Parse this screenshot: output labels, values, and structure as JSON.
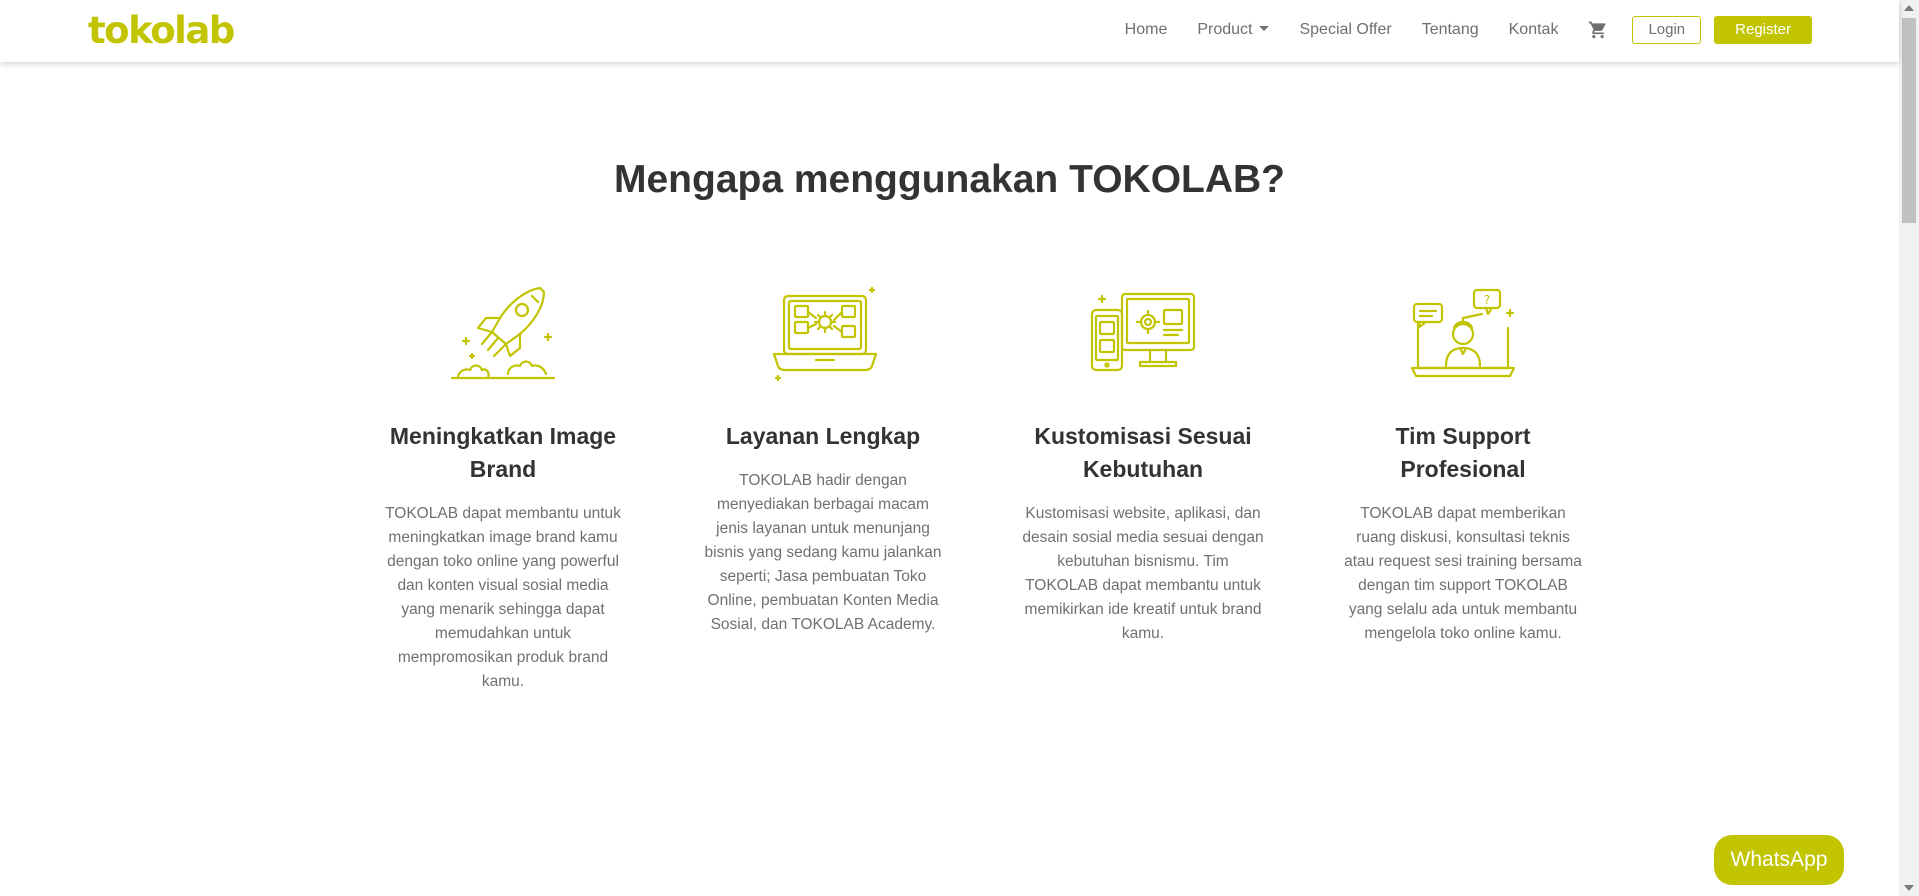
{
  "brand": {
    "name": "tokolab",
    "accent_color": "#c2c400"
  },
  "nav": {
    "home": "Home",
    "product": "Product",
    "special_offer": "Special Offer",
    "tentang": "Tentang",
    "kontak": "Kontak",
    "cart_icon": "shopping-cart-icon",
    "login": "Login",
    "register": "Register"
  },
  "main": {
    "title": "Mengapa menggunakan TOKOLAB?",
    "features": [
      {
        "icon": "rocket-icon",
        "title": "Meningkatkan Image Brand",
        "text": "TOKOLAB dapat membantu untuk meningkatkan image brand kamu dengan toko online yang powerful dan konten visual sosial media yang menarik sehingga dapat memudahkan untuk mempromosikan produk brand kamu."
      },
      {
        "icon": "laptop-settings-icon",
        "title": "Layanan Lengkap",
        "text": "TOKOLAB hadir dengan menyediakan berbagai macam jenis layanan untuk menunjang bisnis yang sedang kamu jalankan seperti; Jasa pembuatan Toko Online, pembuatan Konten Media Sosial, dan TOKOLAB Academy."
      },
      {
        "icon": "devices-customization-icon",
        "title": "Kustomisasi Sesuai Kebutuhan",
        "text": "Kustomisasi website, aplikasi, dan desain sosial media sesuai dengan kebutuhan bisnismu. Tim TOKOLAB dapat membantu untuk memikirkan ide kreatif untuk brand kamu."
      },
      {
        "icon": "support-person-icon",
        "title": "Tim Support Profesional",
        "text": "TOKOLAB dapat memberikan ruang diskusi, konsultasi teknis atau request sesi training bersama dengan tim support TOKOLAB yang selalu ada untuk membantu mengelola toko online kamu."
      }
    ]
  },
  "whatsapp": {
    "label": "WhatsApp"
  }
}
